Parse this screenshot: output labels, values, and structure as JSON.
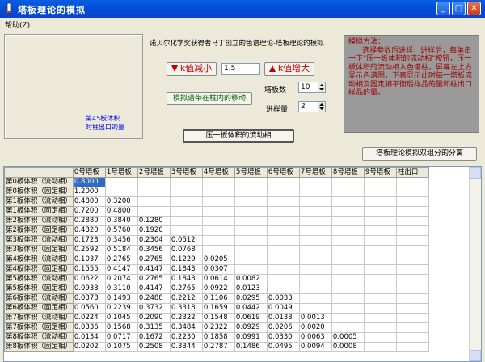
{
  "window": {
    "title": "塔板理论的模拟"
  },
  "menu": {
    "help": "帮助(Z)"
  },
  "left_panel": {
    "line1": "第45板体积",
    "line2": "时柱出口的量"
  },
  "subtitle": "诺贝尔化学奖获得者马丁创立的色谱理论-塔板理论的模拟",
  "k_decrease_label": "k值减小",
  "k_increase_label": "k值增大",
  "k_value": "1.5",
  "move_band_label": "模拟谱带在柱内的移动",
  "plates_label": "塔板数",
  "plates_value": "10",
  "injection_label": "进样量",
  "injection_value": "2",
  "info_text": "模拟方法：\n      选择参数后进样，进样后，每单击一下\"压一板体积的流动相\"按钮，压一板体积的流动相入色谱柱，屏幕左上方显示色谱图，下表显示此时每一塔板流动相及固定相平衡后样品的量和柱出口样品的量。",
  "push_label": "压一板体积的流动相",
  "separation_label": "塔板理论模拟双组分的分离",
  "table": {
    "headers": [
      "",
      "0号塔板",
      "1号塔板",
      "2号塔板",
      "3号塔板",
      "4号塔板",
      "5号塔板",
      "6号塔板",
      "7号塔板",
      "8号塔板",
      "9号塔板",
      "柱出口"
    ],
    "rows": [
      [
        "第0板体积（流动相）",
        "0.8000",
        "",
        "",
        "",
        "",
        "",
        "",
        "",
        "",
        "",
        ""
      ],
      [
        "第0板体积（固定相）",
        "1.2000",
        "",
        "",
        "",
        "",
        "",
        "",
        "",
        "",
        "",
        ""
      ],
      [
        "第1板体积（流动相）",
        "0.4800",
        "0.3200",
        "",
        "",
        "",
        "",
        "",
        "",
        "",
        "",
        ""
      ],
      [
        "第1板体积（固定相）",
        "0.7200",
        "0.4800",
        "",
        "",
        "",
        "",
        "",
        "",
        "",
        "",
        ""
      ],
      [
        "第2板体积（流动相）",
        "0.2880",
        "0.3840",
        "0.1280",
        "",
        "",
        "",
        "",
        "",
        "",
        "",
        ""
      ],
      [
        "第2板体积（固定相）",
        "0.4320",
        "0.5760",
        "0.1920",
        "",
        "",
        "",
        "",
        "",
        "",
        "",
        ""
      ],
      [
        "第3板体积（流动相）",
        "0.1728",
        "0.3456",
        "0.2304",
        "0.0512",
        "",
        "",
        "",
        "",
        "",
        "",
        ""
      ],
      [
        "第3板体积（固定相）",
        "0.2592",
        "0.5184",
        "0.3456",
        "0.0768",
        "",
        "",
        "",
        "",
        "",
        "",
        ""
      ],
      [
        "第4板体积（流动相）",
        "0.1037",
        "0.2765",
        "0.2765",
        "0.1229",
        "0.0205",
        "",
        "",
        "",
        "",
        "",
        ""
      ],
      [
        "第4板体积（固定相）",
        "0.1555",
        "0.4147",
        "0.4147",
        "0.1843",
        "0.0307",
        "",
        "",
        "",
        "",
        "",
        ""
      ],
      [
        "第5板体积（流动相）",
        "0.0622",
        "0.2074",
        "0.2765",
        "0.1843",
        "0.0614",
        "0.0082",
        "",
        "",
        "",
        "",
        ""
      ],
      [
        "第5板体积（固定相）",
        "0.0933",
        "0.3110",
        "0.4147",
        "0.2765",
        "0.0922",
        "0.0123",
        "",
        "",
        "",
        "",
        ""
      ],
      [
        "第6板体积（流动相）",
        "0.0373",
        "0.1493",
        "0.2488",
        "0.2212",
        "0.1106",
        "0.0295",
        "0.0033",
        "",
        "",
        "",
        ""
      ],
      [
        "第6板体积（固定相）",
        "0.0560",
        "0.2239",
        "0.3732",
        "0.3318",
        "0.1659",
        "0.0442",
        "0.0049",
        "",
        "",
        "",
        ""
      ],
      [
        "第7板体积（流动相）",
        "0.0224",
        "0.1045",
        "0.2090",
        "0.2322",
        "0.1548",
        "0.0619",
        "0.0138",
        "0.0013",
        "",
        "",
        ""
      ],
      [
        "第7板体积（固定相）",
        "0.0336",
        "0.1568",
        "0.3135",
        "0.3484",
        "0.2322",
        "0.0929",
        "0.0206",
        "0.0020",
        "",
        "",
        ""
      ],
      [
        "第8板体积（流动相）",
        "0.0134",
        "0.0717",
        "0.1672",
        "0.2230",
        "0.1858",
        "0.0991",
        "0.0330",
        "0.0063",
        "0.0005",
        "",
        ""
      ],
      [
        "第8板体积（固定相）",
        "0.0202",
        "0.1075",
        "0.2508",
        "0.3344",
        "0.2787",
        "0.1486",
        "0.0495",
        "0.0094",
        "0.0008",
        "",
        ""
      ]
    ]
  }
}
